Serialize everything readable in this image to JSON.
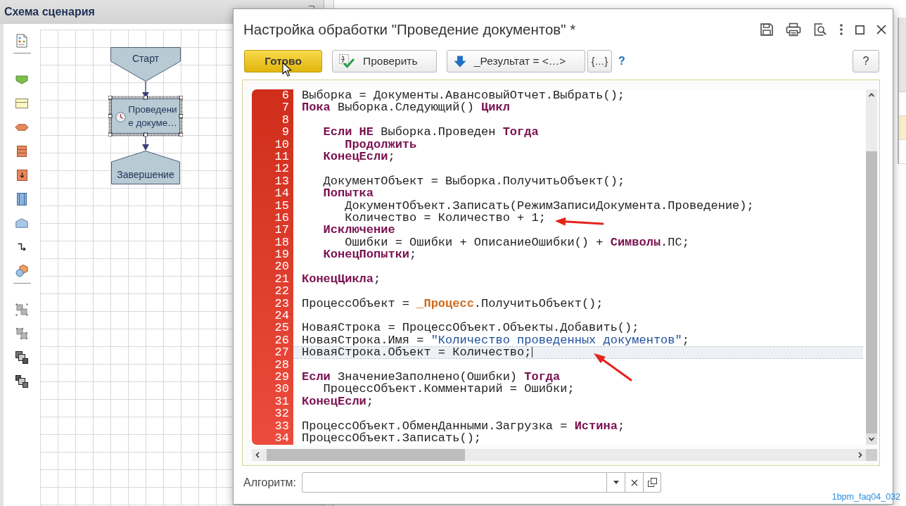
{
  "scheme_panel": {
    "title": "Схема сценария",
    "diagram": {
      "nodes": [
        {
          "kind": "start",
          "label": "Старт",
          "selected": false
        },
        {
          "kind": "action",
          "label": "Проведени е докуме…",
          "selected": true
        },
        {
          "kind": "end",
          "label": "Завершение",
          "selected": false
        }
      ]
    }
  },
  "dialog": {
    "title": "Настройка обработки \"Проведение документов\" *",
    "toolbar": [
      {
        "kind": "primary",
        "label": "Готово"
      },
      {
        "kind": "check",
        "label": "Проверить"
      },
      {
        "kind": "insert",
        "label": "_Результат = <…>"
      },
      {
        "kind": "braces",
        "label": "{…}"
      },
      {
        "kind": "help_link",
        "label": "?"
      }
    ],
    "help_button": "?",
    "editor": {
      "lines": [
        {
          "number": "6",
          "current": false,
          "tokens": [
            {
              "kind": "plain",
              "text": "Выборка = Документы.АвансовыйОтчет.Выбрать();"
            }
          ]
        },
        {
          "number": "7",
          "current": false,
          "tokens": [
            {
              "kind": "keyword",
              "text": "Пока"
            },
            {
              "kind": "plain",
              "text": " Выборка.Следующий() "
            },
            {
              "kind": "keyword",
              "text": "Цикл"
            }
          ]
        },
        {
          "number": "8",
          "current": false
        },
        {
          "number": "9",
          "current": false,
          "tokens": [
            {
              "kind": "keyword",
              "text": "   Если НЕ"
            },
            {
              "kind": "plain",
              "text": " Выборка.Проведен "
            },
            {
              "kind": "keyword",
              "text": "Тогда"
            }
          ]
        },
        {
          "number": "10",
          "current": false,
          "tokens": [
            {
              "kind": "keyword",
              "text": "      Продолжить"
            }
          ]
        },
        {
          "number": "11",
          "current": false,
          "tokens": [
            {
              "kind": "keyword",
              "text": "   КонецЕсли"
            },
            {
              "kind": "plain",
              "text": ";"
            }
          ]
        },
        {
          "number": "12",
          "current": false
        },
        {
          "number": "13",
          "current": false,
          "tokens": [
            {
              "kind": "plain",
              "text": "   ДокументОбъект = Выборка.ПолучитьОбъект();"
            }
          ]
        },
        {
          "number": "14",
          "current": false,
          "tokens": [
            {
              "kind": "keyword",
              "text": "   Попытка"
            }
          ]
        },
        {
          "number": "15",
          "current": false,
          "tokens": [
            {
              "kind": "plain",
              "text": "      ДокументОбъект.Записать(РежимЗаписиДокумента.Проведение);"
            }
          ]
        },
        {
          "number": "16",
          "current": false,
          "tokens": [
            {
              "kind": "plain",
              "text": "      Количество = Количество + 1;"
            }
          ]
        },
        {
          "number": "17",
          "current": false,
          "tokens": [
            {
              "kind": "keyword",
              "text": "   Исключение"
            }
          ]
        },
        {
          "number": "18",
          "current": false,
          "tokens": [
            {
              "kind": "plain",
              "text": "      Ошибки = Ошибки + ОписаниеОшибки() + "
            },
            {
              "kind": "keyword",
              "text": "Символы"
            },
            {
              "kind": "plain",
              "text": ".ПС;"
            }
          ]
        },
        {
          "number": "19",
          "current": false,
          "tokens": [
            {
              "kind": "keyword",
              "text": "   КонецПопытки"
            },
            {
              "kind": "plain",
              "text": ";"
            }
          ]
        },
        {
          "number": "20",
          "current": false
        },
        {
          "number": "21",
          "current": false,
          "tokens": [
            {
              "kind": "keyword",
              "text": "КонецЦикла"
            },
            {
              "kind": "plain",
              "text": ";"
            }
          ]
        },
        {
          "number": "22",
          "current": false
        },
        {
          "number": "23",
          "current": false,
          "tokens": [
            {
              "kind": "plain",
              "text": "ПроцессОбъект = "
            },
            {
              "kind": "global",
              "text": "_Процесс"
            },
            {
              "kind": "plain",
              "text": ".ПолучитьОбъект();"
            }
          ]
        },
        {
          "number": "24",
          "current": false
        },
        {
          "number": "25",
          "current": false,
          "tokens": [
            {
              "kind": "plain",
              "text": "НоваяСтрока = ПроцессОбъект.Объекты.Добавить();"
            }
          ]
        },
        {
          "number": "26",
          "current": false,
          "tokens": [
            {
              "kind": "plain",
              "text": "НоваяСтрока.Имя = "
            },
            {
              "kind": "string",
              "text": "\"Количество проведенных документов\""
            },
            {
              "kind": "plain",
              "text": ";"
            }
          ]
        },
        {
          "number": "27",
          "current": true,
          "tokens": [
            {
              "kind": "plain",
              "text": "НоваяСтрока.Объект = Количество;"
            }
          ]
        },
        {
          "number": "28",
          "current": false
        },
        {
          "number": "29",
          "current": false,
          "tokens": [
            {
              "kind": "keyword",
              "text": "Если"
            },
            {
              "kind": "plain",
              "text": " ЗначениеЗаполнено(Ошибки) "
            },
            {
              "kind": "keyword",
              "text": "Тогда"
            }
          ]
        },
        {
          "number": "30",
          "current": false,
          "tokens": [
            {
              "kind": "plain",
              "text": "   ПроцессОбъект.Комментарий = Ошибки;"
            }
          ]
        },
        {
          "number": "31",
          "current": false,
          "tokens": [
            {
              "kind": "keyword",
              "text": "КонецЕсли"
            },
            {
              "kind": "plain",
              "text": ";"
            }
          ]
        },
        {
          "number": "32",
          "current": false
        },
        {
          "number": "33",
          "current": false,
          "tokens": [
            {
              "kind": "plain",
              "text": "ПроцессОбъект.ОбменДанными.Загрузка = "
            },
            {
              "kind": "keyword",
              "text": "Истина"
            },
            {
              "kind": "plain",
              "text": ";"
            }
          ]
        },
        {
          "number": "34",
          "current": false,
          "tokens": [
            {
              "kind": "plain",
              "text": "ПроцессОбъект.Записать();"
            }
          ]
        }
      ]
    },
    "algorithm_field": {
      "label": "Алгоритм:"
    }
  },
  "caption": "1bpm_faq04_032"
}
